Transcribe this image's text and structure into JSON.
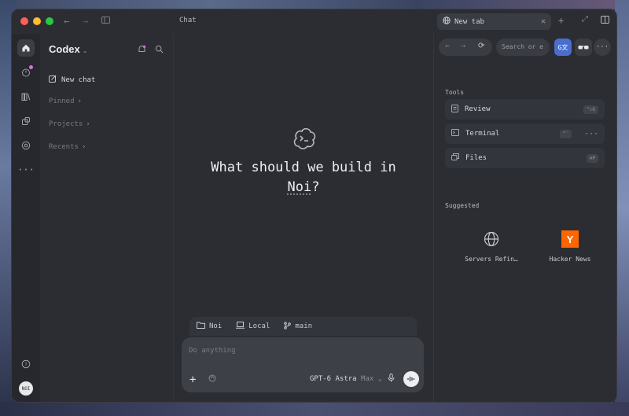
{
  "window": {
    "title": "Chat"
  },
  "browser": {
    "tab_title": "New tab",
    "url_placeholder": "Search or e",
    "tab_close": "✕",
    "new_tab": "+"
  },
  "sidebar": {
    "app_name": "Codex",
    "new_chat": "New chat",
    "groups": [
      {
        "label": "Pinned"
      },
      {
        "label": "Projects"
      },
      {
        "label": "Recents"
      }
    ]
  },
  "main": {
    "hero_line1": "What should we build in",
    "hero_project": "Noi",
    "hero_suffix": "?",
    "context": {
      "folder": "Noi",
      "environment": "Local",
      "branch": "main"
    },
    "composer": {
      "placeholder": "Do anything",
      "model": "GPT-6 Astra",
      "level": "Max"
    }
  },
  "panel": {
    "tools_title": "Tools",
    "tools": [
      {
        "label": "Review",
        "shortcut": "^⇧G"
      },
      {
        "label": "Terminal",
        "shortcut": "^`"
      },
      {
        "label": "Files",
        "shortcut": "⌘P"
      }
    ],
    "suggested_title": "Suggested",
    "suggested": [
      {
        "label": "Servers Refin…"
      },
      {
        "label": "Hacker News",
        "logo": "Y"
      }
    ]
  },
  "user": {
    "avatar_text": "NOI"
  },
  "colors": {
    "accent_notification": "#e06fd8",
    "hacker_news": "#ff6600"
  }
}
